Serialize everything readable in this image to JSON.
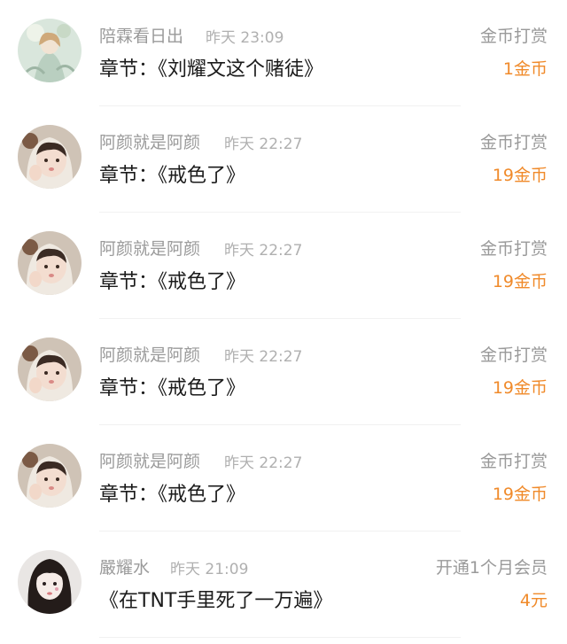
{
  "records": [
    {
      "name": "陪霖看日出",
      "time": "昨天 23:09",
      "content": "章节：《刘耀文这个赌徒》",
      "type": "金币打赏",
      "amount": "1金币",
      "avatar": "avatar-anime-girl"
    },
    {
      "name": "阿颜就是阿颜",
      "time": "昨天 22:27",
      "content": "章节：《戒色了》",
      "type": "金币打赏",
      "amount": "19金币",
      "avatar": "avatar-hooded-girl"
    },
    {
      "name": "阿颜就是阿颜",
      "time": "昨天 22:27",
      "content": "章节：《戒色了》",
      "type": "金币打赏",
      "amount": "19金币",
      "avatar": "avatar-hooded-girl"
    },
    {
      "name": "阿颜就是阿颜",
      "time": "昨天 22:27",
      "content": "章节：《戒色了》",
      "type": "金币打赏",
      "amount": "19金币",
      "avatar": "avatar-hooded-girl"
    },
    {
      "name": "阿颜就是阿颜",
      "time": "昨天 22:27",
      "content": "章节：《戒色了》",
      "type": "金币打赏",
      "amount": "19金币",
      "avatar": "avatar-hooded-girl"
    },
    {
      "name": "嚴耀水",
      "time": "昨天 21:09",
      "content": "《在TNT手里死了一万遍》",
      "type": "开通1个月会员",
      "amount": "4元",
      "avatar": "avatar-dark-hair-girl"
    }
  ],
  "colors": {
    "amount": "#f08a2a",
    "name": "#9a9a9a",
    "content": "#1b1b1b"
  }
}
